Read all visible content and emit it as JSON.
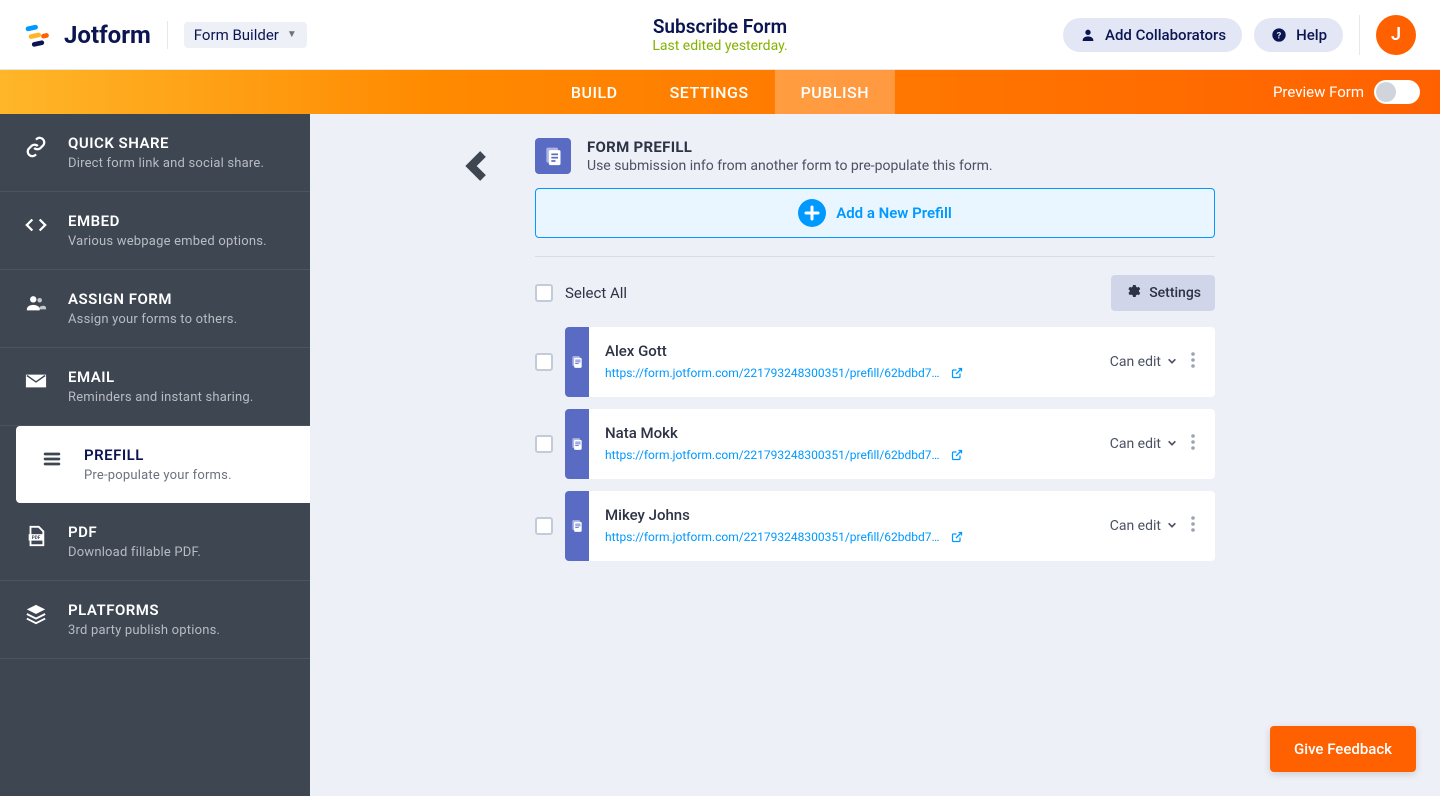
{
  "header": {
    "logo_text": "Jotform",
    "form_builder_label": "Form Builder",
    "form_title": "Subscribe Form",
    "last_edited": "Last edited yesterday.",
    "add_collaborators": "Add Collaborators",
    "help": "Help",
    "avatar_initial": "J"
  },
  "tabs": {
    "build": "BUILD",
    "settings": "SETTINGS",
    "publish": "PUBLISH",
    "preview_label": "Preview Form"
  },
  "sidebar": {
    "items": [
      {
        "title": "QUICK SHARE",
        "sub": "Direct form link and social share.",
        "icon": "link"
      },
      {
        "title": "EMBED",
        "sub": "Various webpage embed options.",
        "icon": "code"
      },
      {
        "title": "ASSIGN FORM",
        "sub": "Assign your forms to others.",
        "icon": "users"
      },
      {
        "title": "EMAIL",
        "sub": "Reminders and instant sharing.",
        "icon": "mail"
      },
      {
        "title": "PREFILL",
        "sub": "Pre-populate your forms.",
        "icon": "stack",
        "active": true
      },
      {
        "title": "PDF",
        "sub": "Download fillable PDF.",
        "icon": "pdf"
      },
      {
        "title": "PLATFORMS",
        "sub": "3rd party publish options.",
        "icon": "layers"
      }
    ]
  },
  "panel": {
    "title": "FORM PREFILL",
    "subtitle": "Use submission info from another form to pre-populate this form.",
    "add_label": "Add a New Prefill",
    "select_all": "Select All",
    "settings_btn": "Settings",
    "permission_label": "Can edit",
    "rows": [
      {
        "name": "Alex Gott",
        "url": "https://form.jotform.com/221793248300351/prefill/62bdbd79b046..."
      },
      {
        "name": "Nata Mokk",
        "url": "https://form.jotform.com/221793248300351/prefill/62bdbd79b046..."
      },
      {
        "name": "Mikey Johns",
        "url": "https://form.jotform.com/221793248300351/prefill/62bdbd79b046..."
      }
    ]
  },
  "feedback": "Give Feedback"
}
